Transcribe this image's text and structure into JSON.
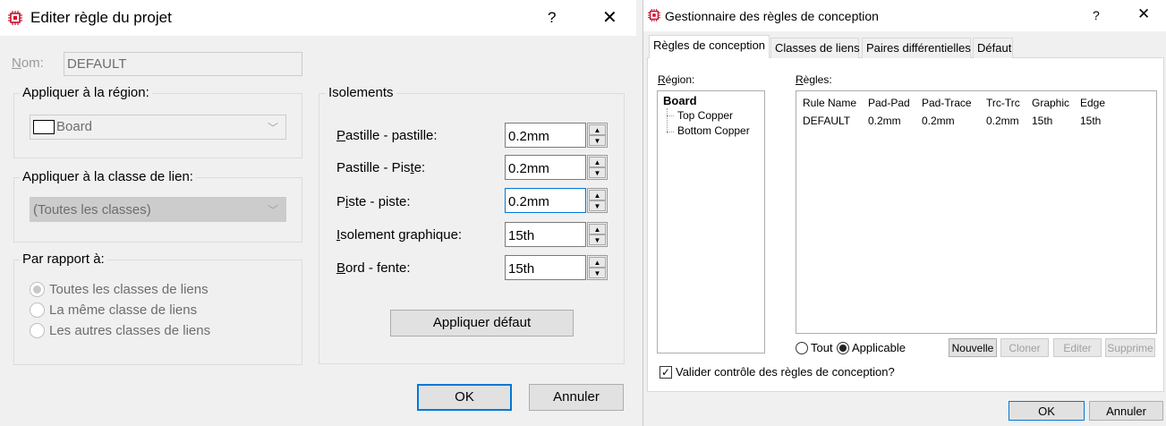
{
  "left_dialog": {
    "title": "Editer règle du projet",
    "help": "?",
    "close": "✕",
    "name_label": "Nom:",
    "name_value": "DEFAULT",
    "region_group": "Appliquer à la région:",
    "region_value": "Board",
    "netclass_group": "Appliquer à la classe de lien:",
    "netclass_value": "(Toutes les classes)",
    "relative_group": "Par rapport à:",
    "relative_options": [
      {
        "label": "Toutes les classes de liens",
        "selected": true
      },
      {
        "label": "La même classe de liens",
        "selected": false
      },
      {
        "label": "Les autres classes de liens",
        "selected": false
      }
    ],
    "clearance_group": "Isolements",
    "clearances": [
      {
        "label": "Pastille - pastille:",
        "value": "0.2mm"
      },
      {
        "label": "Pastille - Piste:",
        "value": "0.2mm"
      },
      {
        "label": "Piste - piste:",
        "value": "0.2mm"
      },
      {
        "label": "Isolement graphique:",
        "value": "15th"
      },
      {
        "label": "Bord - fente:",
        "value": "15th"
      }
    ],
    "apply_default": "Appliquer défaut",
    "ok": "OK",
    "cancel": "Annuler"
  },
  "right_dialog": {
    "title": "Gestionnaire des règles de conception",
    "help": "?",
    "close": "✕",
    "tabs": [
      "Règles de conception",
      "Classes de liens",
      "Paires différentielles",
      "Défaut"
    ],
    "active_tab": 0,
    "region_label": "Région:",
    "regions": [
      {
        "label": "Board",
        "level": 0
      },
      {
        "label": "Top Copper",
        "level": 1
      },
      {
        "label": "Bottom Copper",
        "level": 1
      }
    ],
    "rules_label": "Règles:",
    "rules_columns": [
      "Rule Name",
      "Pad-Pad",
      "Pad-Trace",
      "Trc-Trc",
      "Graphic",
      "Edge"
    ],
    "rules_rows": [
      [
        "DEFAULT",
        "0.2mm",
        "0.2mm",
        "0.2mm",
        "15th",
        "15th"
      ]
    ],
    "filter_all": "Tout",
    "filter_applicable": "Applicable",
    "filter_selected": "Applicable",
    "btn_new": "Nouvelle",
    "btn_clone": "Cloner",
    "btn_edit": "Editer",
    "btn_delete": "Supprime",
    "validate_label": "Valider contrôle des règles de conception?",
    "validate_checked": true,
    "ok": "OK",
    "cancel": "Annuler"
  },
  "colors": {
    "accent": "#0078d7",
    "icon_red": "#c8102e",
    "dialog_bg": "#f0f0f0"
  }
}
